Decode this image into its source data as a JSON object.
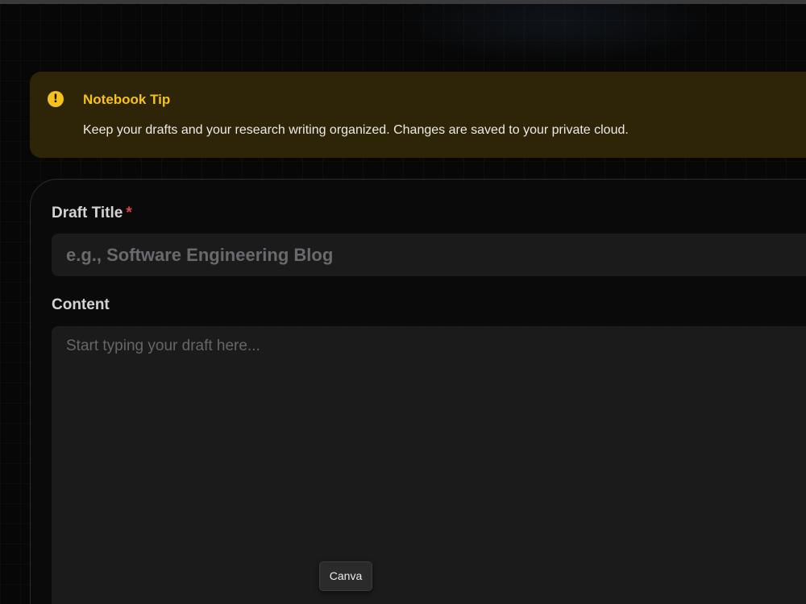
{
  "tip": {
    "icon": "exclamation-circle-icon",
    "icon_glyph": "!",
    "title": "Notebook Tip",
    "body": "Keep your drafts and your research writing organized. Changes are saved to your private cloud.",
    "accent_color": "#f5c21b"
  },
  "form": {
    "title_field": {
      "label": "Draft Title",
      "required_mark": "*",
      "value": "",
      "placeholder": "e.g., Software Engineering Blog"
    },
    "content_field": {
      "label": "Content",
      "value": "",
      "placeholder": "Start typing your draft here..."
    }
  },
  "tooltip": {
    "label": "Canva"
  }
}
